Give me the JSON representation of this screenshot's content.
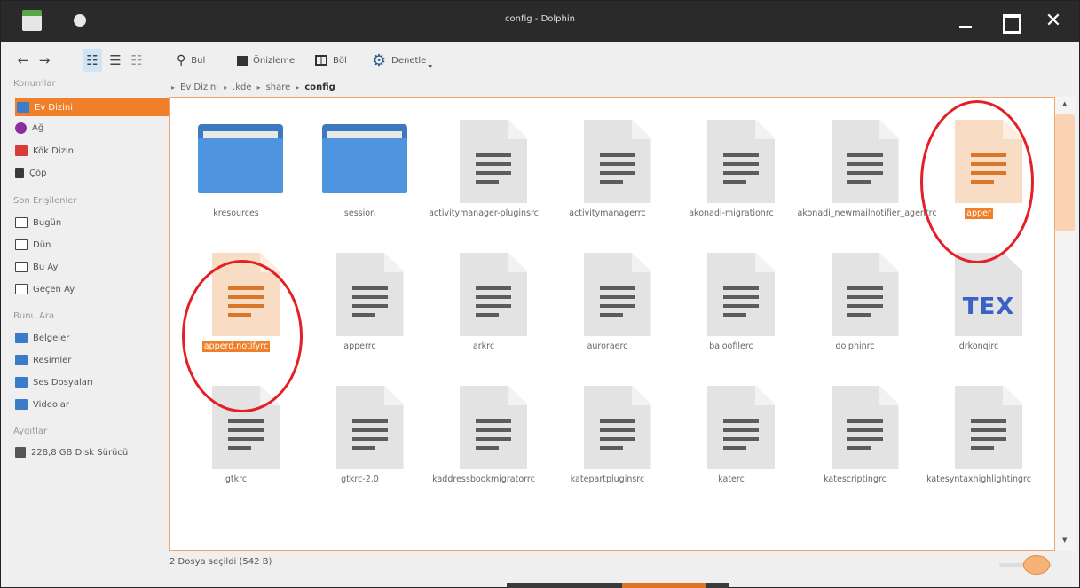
{
  "window": {
    "title": "config - Dolphin"
  },
  "toolbar": {
    "find_label": "Bul",
    "preview_label": "Önizleme",
    "split_label": "Böl",
    "control_label": "Denetle"
  },
  "sidebar": {
    "places_header": "Konumlar",
    "places": [
      {
        "label": "Ev Dizini",
        "icon": "home-folder-icon",
        "selected": true
      },
      {
        "label": "Ağ",
        "icon": "network-icon"
      },
      {
        "label": "Kök Dizin",
        "icon": "root-folder-icon"
      },
      {
        "label": "Çöp",
        "icon": "trash-icon"
      }
    ],
    "recent_header": "Son Erişilenler",
    "recent": [
      {
        "label": "Bugün"
      },
      {
        "label": "Dün"
      },
      {
        "label": "Bu Ay"
      },
      {
        "label": "Geçen Ay"
      }
    ],
    "search_header": "Bunu Ara",
    "search": [
      {
        "label": "Belgeler"
      },
      {
        "label": "Resimler"
      },
      {
        "label": "Ses Dosyaları"
      },
      {
        "label": "Videolar"
      }
    ],
    "devices_header": "Aygıtlar",
    "devices": [
      {
        "label": "228,8 GB Disk Sürücü"
      }
    ]
  },
  "breadcrumb": [
    "Ev Dizini",
    ".kde",
    "share",
    "config"
  ],
  "files": [
    {
      "name": "kresources",
      "type": "folder"
    },
    {
      "name": "session",
      "type": "folder"
    },
    {
      "name": "activitymanager-pluginsrc",
      "type": "text"
    },
    {
      "name": "activitymanagerrc",
      "type": "text"
    },
    {
      "name": "akonadi-migrationrc",
      "type": "text"
    },
    {
      "name": "akonadi_newmailnotifier_agentrc",
      "type": "text"
    },
    {
      "name": "apper",
      "type": "text",
      "selected": true
    },
    {
      "name": "apperd.notifyrc",
      "type": "text",
      "selected": true
    },
    {
      "name": "apperrc",
      "type": "text"
    },
    {
      "name": "arkrc",
      "type": "text"
    },
    {
      "name": "auroraerc",
      "type": "text"
    },
    {
      "name": "baloofilerc",
      "type": "text"
    },
    {
      "name": "dolphinrc",
      "type": "text"
    },
    {
      "name": "drkonqirc",
      "type": "tex"
    },
    {
      "name": "gtkrc",
      "type": "text"
    },
    {
      "name": "gtkrc-2.0",
      "type": "text"
    },
    {
      "name": "kaddressbookmigratorrc",
      "type": "text"
    },
    {
      "name": "katepartpluginsrc",
      "type": "text"
    },
    {
      "name": "katerc",
      "type": "text"
    },
    {
      "name": "katescriptingrc",
      "type": "text"
    },
    {
      "name": "katesyntaxhighlightingrc",
      "type": "text"
    }
  ],
  "tex_label": "TEX",
  "status": {
    "text": "2 Dosya seçildi (542 B)"
  },
  "colors": {
    "accent": "#f07f2a",
    "folder": "#4f94de",
    "annotation": "#e32025"
  }
}
